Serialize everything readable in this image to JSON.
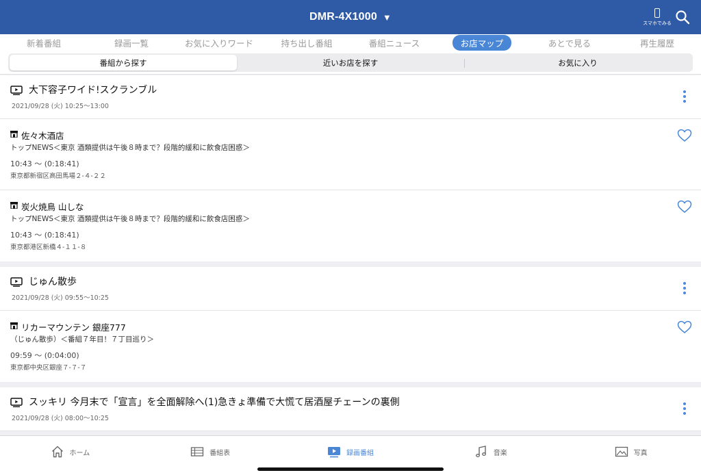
{
  "header": {
    "title": "DMR-4X1000",
    "caret": "▼",
    "phone_label": "スマホでみる"
  },
  "tabs": [
    {
      "label": "新着番組",
      "active": false
    },
    {
      "label": "録画一覧",
      "active": false
    },
    {
      "label": "お気に入りワード",
      "active": false
    },
    {
      "label": "持ち出し番組",
      "active": false
    },
    {
      "label": "番組ニュース",
      "active": false
    },
    {
      "label": "お店マップ",
      "active": true
    },
    {
      "label": "あとで見る",
      "active": false
    },
    {
      "label": "再生履歴",
      "active": false
    }
  ],
  "segments": [
    {
      "label": "番組から探す",
      "active": true
    },
    {
      "label": "近いお店を探す",
      "active": false
    },
    {
      "label": "お気に入り",
      "active": false
    }
  ],
  "groups": [
    {
      "program": {
        "title": "大下容子ワイド!スクランブル",
        "date": "2021/09/28 (火)  10:25～13:00"
      },
      "shops": [
        {
          "name": "佐々木酒店",
          "desc": "トップNEWS＜東京 酒類提供は午後８時まで？段階的緩和に飲食店困惑＞",
          "time": "10:43 ～ (0:18:41)",
          "addr": "東京都新宿区高田馬場２-４-２２"
        },
        {
          "name": "炭火焼鳥 山しな",
          "desc": "トップNEWS＜東京 酒類提供は午後８時まで？段階的緩和に飲食店困惑＞",
          "time": "10:43 ～ (0:18:41)",
          "addr": "東京都港区新橋４-１１-８"
        }
      ]
    },
    {
      "program": {
        "title": "じゅん散歩",
        "date": "2021/09/28 (火)  09:55～10:25"
      },
      "shops": [
        {
          "name": "リカーマウンテン 銀座777",
          "desc": "（じゅん散歩）＜番組７年目！７丁目巡り＞",
          "time": "09:59 ～ (0:04:00)",
          "addr": "東京都中央区銀座７-７-７"
        }
      ]
    },
    {
      "program": {
        "title": "スッキリ 今月末で「宣言」を全面解除へ(1)急きょ準備で大慌て居酒屋チェーンの裏側",
        "date": "2021/09/28 (火)  08:00～10:25"
      },
      "shops": []
    }
  ],
  "bottom_nav": [
    {
      "label": "ホーム",
      "icon": "home-icon",
      "active": false
    },
    {
      "label": "番組表",
      "icon": "grid-icon",
      "active": false
    },
    {
      "label": "録画番組",
      "icon": "play-icon",
      "active": true
    },
    {
      "label": "音楽",
      "icon": "music-icon",
      "active": false
    },
    {
      "label": "写真",
      "icon": "photo-icon",
      "active": false
    }
  ],
  "colors": {
    "header": "#2f5aa6",
    "accent": "#4a86d6"
  }
}
